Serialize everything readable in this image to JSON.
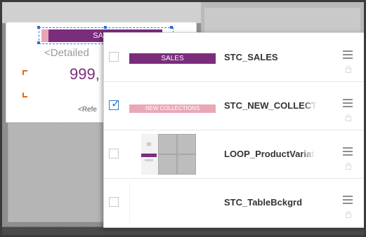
{
  "canvas": {
    "sales_banner_text": "SALES",
    "detailed_text": "<Detailed",
    "price_text": "999,",
    "ref_text": "<Refe"
  },
  "popup": {
    "items": [
      {
        "checked": false,
        "thumb_text": "SALES",
        "name": "STC_SALES",
        "icon": "drag-handle-icon"
      },
      {
        "checked": true,
        "thumb_text": "NEW COLLECTIONS",
        "name": "STC_NEW_COLLECT",
        "icon": "drag-handle-icon"
      },
      {
        "checked": false,
        "thumb_text": "",
        "name": "LOOP_ProductVariat",
        "icon": "drag-handle-icon"
      },
      {
        "checked": false,
        "thumb_text": "",
        "name": "STC_TableBckgrd",
        "icon": "drag-handle-icon"
      }
    ]
  },
  "colors": {
    "accent_purple": "#7b2d7d",
    "accent_pink": "#eba7b6",
    "checkbox_blue": "#2a7fd4"
  }
}
